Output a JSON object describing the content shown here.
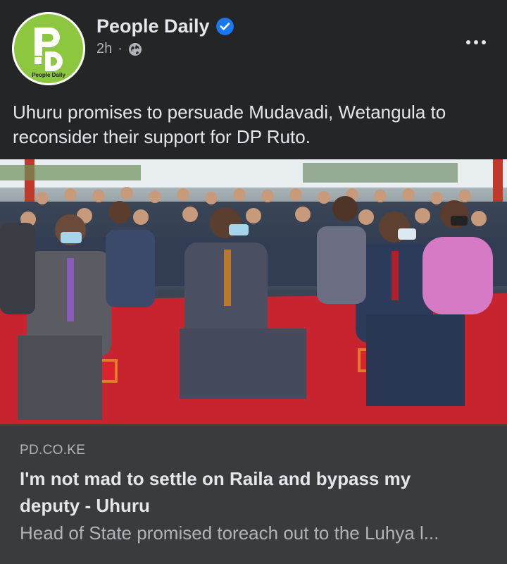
{
  "header": {
    "page_name": "People Daily",
    "timestamp": "2h",
    "separator": "·",
    "avatar_logo_text": "People Daily",
    "icons": {
      "verified": "verified-badge-icon",
      "audience": "globe-icon",
      "more": "more-options-icon"
    },
    "colors": {
      "verified": "#1877f2",
      "logo_green": "#8dc63f"
    }
  },
  "post": {
    "text": "Uhuru promises to persuade Mudavadi, Wetangula to reconsider their support for DP Ruto."
  },
  "link_preview": {
    "domain": "PD.CO.KE",
    "title": "I'm not mad to settle on Raila and bypass my deputy - Uhuru",
    "description": "Head of State promised toreach out to the Luhya l..."
  },
  "colors": {
    "background": "#242526",
    "card": "#3a3b3c",
    "text_primary": "#e4e6eb",
    "text_secondary": "#b0b3b8"
  }
}
